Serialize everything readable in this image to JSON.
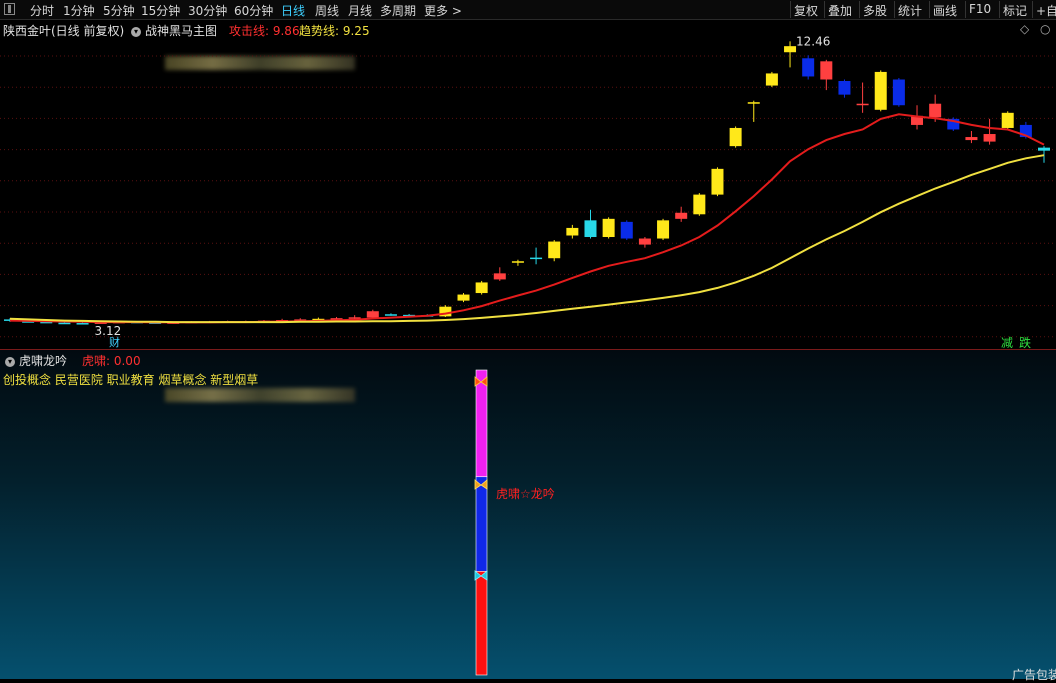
{
  "toolbar": {
    "periods": [
      {
        "label": "分时",
        "active": false
      },
      {
        "label": "1分钟",
        "active": false
      },
      {
        "label": "5分钟",
        "active": false
      },
      {
        "label": "15分钟",
        "active": false
      },
      {
        "label": "30分钟",
        "active": false
      },
      {
        "label": "60分钟",
        "active": false
      },
      {
        "label": "日线",
        "active": true
      },
      {
        "label": "周线",
        "active": false
      },
      {
        "label": "月线",
        "active": false
      },
      {
        "label": "多周期",
        "active": false
      },
      {
        "label": "更多 >",
        "active": false
      }
    ],
    "right_buttons": [
      "复权",
      "叠加",
      "多股",
      "统计",
      "画线",
      "F10",
      "标记",
      "+自"
    ]
  },
  "main_header": {
    "stock": "陕西金叶(日线 前复权)",
    "indicator": "战神黑马主图",
    "attack_label": "攻击线: 9.86",
    "trend_label": "趋势线: 9.25",
    "diamond_icon": "diamond-icon"
  },
  "annotations": {
    "high_label": "12.46",
    "low_label": "3.12",
    "cai_label": "财",
    "jian_label": "减",
    "die_label": "跌"
  },
  "sub_header": {
    "title": "虎啸龙吟",
    "value_label": "虎啸: 0.00",
    "concepts": "创投概念 民营医院 职业教育 烟草概念 新型烟草",
    "bar_label": "虎啸☆龙吟",
    "ad_text": "广告包装"
  },
  "colors": {
    "up": "#ff4040",
    "down": "#0a2ce8",
    "yellow": "#ffe81a",
    "cyan": "#28d8e8",
    "attack_line": "#e41c1c",
    "trend_line": "#f0e040",
    "grid": "#5a1010"
  },
  "chart_data": {
    "type": "candlestick",
    "ylim": [
      2.6,
      12.9
    ],
    "grid": true,
    "series_lines": [
      "attack",
      "trend"
    ],
    "candles": [
      {
        "o": 3.28,
        "c": 3.24,
        "h": 3.32,
        "l": 3.2,
        "color": "cyan"
      },
      {
        "o": 3.22,
        "c": 3.2,
        "h": 3.26,
        "l": 3.18,
        "color": "cyan"
      },
      {
        "o": 3.2,
        "c": 3.18,
        "h": 3.23,
        "l": 3.16,
        "color": "cyan"
      },
      {
        "o": 3.17,
        "c": 3.15,
        "h": 3.2,
        "l": 3.13,
        "color": "cyan"
      },
      {
        "o": 3.16,
        "c": 3.14,
        "h": 3.18,
        "l": 3.12,
        "color": "cyan"
      },
      {
        "o": 3.16,
        "c": 3.18,
        "h": 3.22,
        "l": 3.14,
        "color": "up"
      },
      {
        "o": 3.2,
        "c": 3.19,
        "h": 3.23,
        "l": 3.17,
        "color": "up"
      },
      {
        "o": 3.2,
        "c": 3.18,
        "h": 3.22,
        "l": 3.16,
        "color": "cyan"
      },
      {
        "o": 3.18,
        "c": 3.16,
        "h": 3.2,
        "l": 3.14,
        "color": "cyan"
      },
      {
        "o": 3.16,
        "c": 3.18,
        "h": 3.2,
        "l": 3.14,
        "color": "up"
      },
      {
        "o": 3.18,
        "c": 3.2,
        "h": 3.22,
        "l": 3.16,
        "color": "up"
      },
      {
        "o": 3.2,
        "c": 3.21,
        "h": 3.23,
        "l": 3.18,
        "color": "up"
      },
      {
        "o": 3.21,
        "c": 3.22,
        "h": 3.24,
        "l": 3.19,
        "color": "up"
      },
      {
        "o": 3.22,
        "c": 3.21,
        "h": 3.24,
        "l": 3.2,
        "color": "up"
      },
      {
        "o": 3.22,
        "c": 3.24,
        "h": 3.26,
        "l": 3.2,
        "color": "up"
      },
      {
        "o": 3.22,
        "c": 3.26,
        "h": 3.3,
        "l": 3.2,
        "color": "up"
      },
      {
        "o": 3.25,
        "c": 3.28,
        "h": 3.32,
        "l": 3.23,
        "color": "up"
      },
      {
        "o": 3.28,
        "c": 3.3,
        "h": 3.34,
        "l": 3.26,
        "color": "yellow"
      },
      {
        "o": 3.3,
        "c": 3.32,
        "h": 3.36,
        "l": 3.28,
        "color": "up"
      },
      {
        "o": 3.3,
        "c": 3.35,
        "h": 3.42,
        "l": 3.28,
        "color": "up"
      },
      {
        "o": 3.34,
        "c": 3.55,
        "h": 3.6,
        "l": 3.32,
        "color": "up"
      },
      {
        "o": 3.45,
        "c": 3.43,
        "h": 3.48,
        "l": 3.4,
        "color": "cyan"
      },
      {
        "o": 3.42,
        "c": 3.43,
        "h": 3.46,
        "l": 3.4,
        "color": "cyan"
      },
      {
        "o": 3.41,
        "c": 3.42,
        "h": 3.45,
        "l": 3.38,
        "color": "cyan"
      },
      {
        "o": 3.38,
        "c": 3.7,
        "h": 3.75,
        "l": 3.36,
        "color": "yellow"
      },
      {
        "o": 3.9,
        "c": 4.1,
        "h": 4.15,
        "l": 3.85,
        "color": "yellow"
      },
      {
        "o": 4.15,
        "c": 4.5,
        "h": 4.55,
        "l": 4.1,
        "color": "yellow"
      },
      {
        "o": 4.6,
        "c": 4.8,
        "h": 5.0,
        "l": 4.55,
        "color": "up"
      },
      {
        "o": 5.15,
        "c": 5.2,
        "h": 5.25,
        "l": 5.05,
        "color": "yellow"
      },
      {
        "o": 5.3,
        "c": 5.32,
        "h": 5.65,
        "l": 5.1,
        "color": "cyan"
      },
      {
        "o": 5.3,
        "c": 5.85,
        "h": 5.9,
        "l": 5.2,
        "color": "yellow"
      },
      {
        "o": 6.05,
        "c": 6.3,
        "h": 6.4,
        "l": 5.95,
        "color": "yellow"
      },
      {
        "o": 6.0,
        "c": 6.55,
        "h": 6.9,
        "l": 5.95,
        "color": "cyan"
      },
      {
        "o": 6.0,
        "c": 6.6,
        "h": 6.65,
        "l": 5.95,
        "color": "yellow"
      },
      {
        "o": 6.5,
        "c": 5.95,
        "h": 6.55,
        "l": 5.9,
        "color": "down"
      },
      {
        "o": 5.95,
        "c": 5.75,
        "h": 6.0,
        "l": 5.65,
        "color": "up"
      },
      {
        "o": 5.95,
        "c": 6.55,
        "h": 6.6,
        "l": 5.9,
        "color": "yellow"
      },
      {
        "o": 6.6,
        "c": 6.8,
        "h": 7.0,
        "l": 6.5,
        "color": "up"
      },
      {
        "o": 6.75,
        "c": 7.4,
        "h": 7.45,
        "l": 6.7,
        "color": "yellow"
      },
      {
        "o": 7.4,
        "c": 8.25,
        "h": 8.3,
        "l": 7.35,
        "color": "yellow"
      },
      {
        "o": 9.0,
        "c": 9.6,
        "h": 9.65,
        "l": 8.95,
        "color": "yellow"
      },
      {
        "o": 10.4,
        "c": 10.45,
        "h": 10.5,
        "l": 9.8,
        "color": "yellow"
      },
      {
        "o": 11.0,
        "c": 11.4,
        "h": 11.45,
        "l": 10.95,
        "color": "yellow"
      },
      {
        "o": 12.1,
        "c": 12.3,
        "h": 12.46,
        "l": 11.6,
        "color": "yellow"
      },
      {
        "o": 11.9,
        "c": 11.3,
        "h": 12.0,
        "l": 11.2,
        "color": "down"
      },
      {
        "o": 11.8,
        "c": 11.2,
        "h": 11.85,
        "l": 10.85,
        "color": "up"
      },
      {
        "o": 11.15,
        "c": 10.7,
        "h": 11.2,
        "l": 10.6,
        "color": "down"
      },
      {
        "o": 10.4,
        "c": 10.35,
        "h": 11.1,
        "l": 10.1,
        "color": "up"
      },
      {
        "o": 10.2,
        "c": 11.45,
        "h": 11.5,
        "l": 10.15,
        "color": "yellow"
      },
      {
        "o": 11.2,
        "c": 10.35,
        "h": 11.25,
        "l": 10.3,
        "color": "down"
      },
      {
        "o": 10.0,
        "c": 9.7,
        "h": 10.35,
        "l": 9.55,
        "color": "up"
      },
      {
        "o": 10.4,
        "c": 9.95,
        "h": 10.7,
        "l": 9.8,
        "color": "up"
      },
      {
        "o": 9.9,
        "c": 9.55,
        "h": 9.95,
        "l": 9.5,
        "color": "down"
      },
      {
        "o": 9.3,
        "c": 9.2,
        "h": 9.5,
        "l": 9.1,
        "color": "up"
      },
      {
        "o": 9.4,
        "c": 9.15,
        "h": 9.9,
        "l": 9.05,
        "color": "up"
      },
      {
        "o": 9.6,
        "c": 10.1,
        "h": 10.15,
        "l": 9.55,
        "color": "yellow"
      },
      {
        "o": 9.7,
        "c": 9.3,
        "h": 9.8,
        "l": 9.25,
        "color": "down"
      },
      {
        "o": 8.95,
        "c": 8.85,
        "h": 9.0,
        "l": 8.45,
        "color": "cyan"
      }
    ],
    "attack": [
      3.24,
      3.23,
      3.22,
      3.21,
      3.2,
      3.19,
      3.19,
      3.19,
      3.18,
      3.18,
      3.18,
      3.18,
      3.19,
      3.19,
      3.2,
      3.21,
      3.22,
      3.23,
      3.25,
      3.27,
      3.31,
      3.34,
      3.37,
      3.4,
      3.47,
      3.58,
      3.72,
      3.9,
      4.07,
      4.23,
      4.43,
      4.65,
      4.86,
      5.05,
      5.18,
      5.3,
      5.5,
      5.72,
      6.0,
      6.38,
      6.85,
      7.35,
      7.9,
      8.5,
      8.9,
      9.2,
      9.4,
      9.55,
      9.9,
      10.05,
      9.98,
      9.92,
      9.83,
      9.7,
      9.6,
      9.55,
      9.35,
      9.05
    ],
    "trend": [
      3.3,
      3.28,
      3.26,
      3.24,
      3.23,
      3.22,
      3.21,
      3.2,
      3.2,
      3.19,
      3.19,
      3.19,
      3.19,
      3.19,
      3.19,
      3.19,
      3.2,
      3.2,
      3.21,
      3.21,
      3.22,
      3.22,
      3.23,
      3.24,
      3.26,
      3.29,
      3.33,
      3.38,
      3.43,
      3.49,
      3.56,
      3.63,
      3.7,
      3.77,
      3.84,
      3.91,
      3.99,
      4.08,
      4.18,
      4.32,
      4.5,
      4.72,
      4.98,
      5.3,
      5.62,
      5.92,
      6.2,
      6.5,
      6.82,
      7.1,
      7.35,
      7.6,
      7.82,
      8.05,
      8.25,
      8.45,
      8.6,
      8.7
    ]
  },
  "sub_chart_data": {
    "type": "bar",
    "segments": [
      {
        "name": "magenta",
        "from": 0,
        "to": 0.35,
        "color": "#f020f0"
      },
      {
        "name": "blue",
        "from": 0.35,
        "to": 0.66,
        "color": "#1028e8"
      },
      {
        "name": "red",
        "from": 0.66,
        "to": 1.0,
        "color": "#ff1010"
      }
    ]
  }
}
